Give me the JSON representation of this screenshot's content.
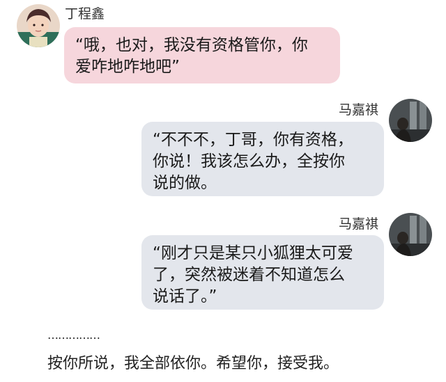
{
  "messages": [
    {
      "sender": "丁程鑫",
      "lines": [
        "“哦，也对，我没有资格管你，你",
        "爱咋地咋地吧”"
      ],
      "color": "#f6d6dc"
    },
    {
      "sender": "马嘉祺",
      "lines": [
        "“不不不，丁哥，你有资格，",
        "你说！我该怎么办，全按你",
        "说的做。"
      ],
      "color": "#e3e6ec"
    },
    {
      "sender": "马嘉祺",
      "lines": [
        "“刚才只是某只小狐狸太可爱",
        "了，突然被迷着不知道怎么",
        "说话了。”"
      ],
      "color": "#e3e6ec"
    }
  ],
  "narration": {
    "ellipsis": "……………",
    "text": "按你所说，我全部依你。希望你，接受我。"
  }
}
